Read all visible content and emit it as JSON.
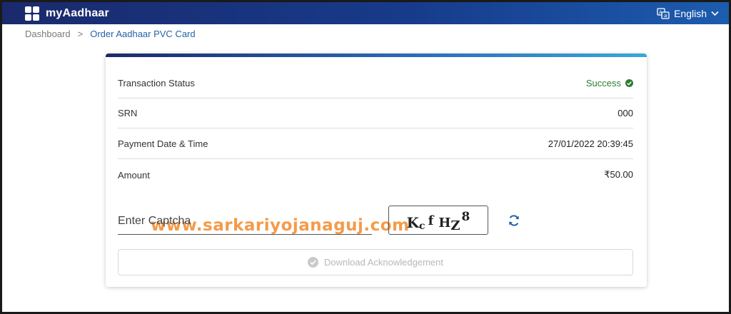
{
  "header": {
    "app_name": "myAadhaar",
    "language": "English",
    "icons": {
      "logo": "grid-logo-icon",
      "language": "translate-icon",
      "dropdown": "chevron-down-icon"
    }
  },
  "breadcrumb": {
    "home": "Dashboard",
    "separator": ">",
    "current": "Order Aadhaar PVC Card"
  },
  "details": {
    "rows": [
      {
        "label": "Transaction Status",
        "value": "Success"
      },
      {
        "label": "SRN",
        "value": "000"
      },
      {
        "label": "Payment Date & Time",
        "value": "27/01/2022 20:39:45"
      },
      {
        "label": "Amount",
        "value": "₹50.00"
      }
    ],
    "status_color": "#2e7d32"
  },
  "watermark": "www.sarkariyojanaguj.com",
  "captcha": {
    "placeholder": "Enter Captcha",
    "image_text": "KcfHZ8",
    "refresh_icon": "refresh-icon"
  },
  "download_button": {
    "label": "Download Acknowledgement",
    "icon": "check-circle-icon",
    "enabled": false
  },
  "colors": {
    "brand": "#1a2a6c",
    "accent": "#2563a6",
    "success": "#2e7d32",
    "watermark": "#f28a2b"
  }
}
